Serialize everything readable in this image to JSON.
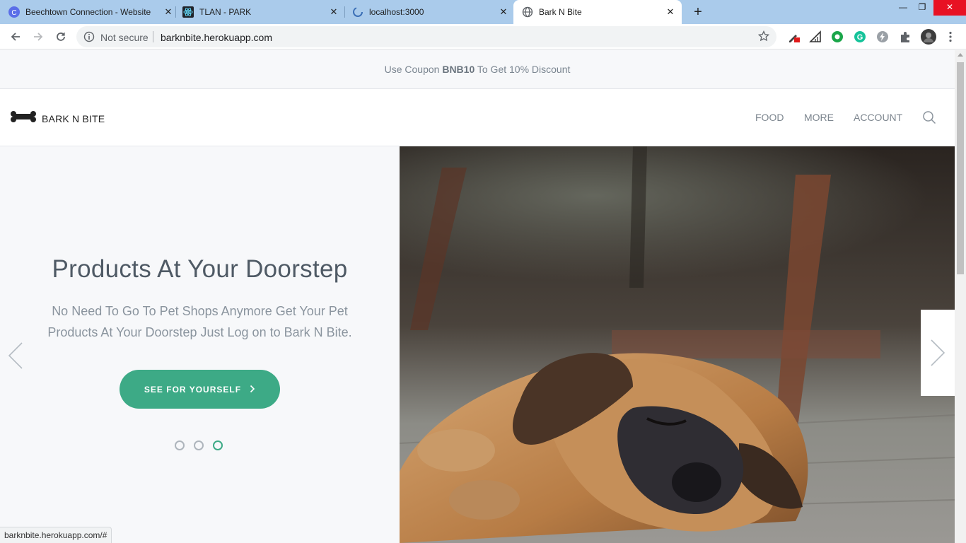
{
  "browser": {
    "tabs": [
      {
        "title": "Beechtown Connection - Website",
        "icon": "c-logo-icon"
      },
      {
        "title": "TLAN - PARK",
        "icon": "react-icon"
      },
      {
        "title": "localhost:3000",
        "icon": "spinner-icon"
      },
      {
        "title": "Bark N Bite",
        "icon": "globe-icon",
        "active": true
      }
    ],
    "security_label": "Not secure",
    "url": "barknbite.herokuapp.com",
    "status_url": "barknbite.herokuapp.com/#"
  },
  "site": {
    "coupon": {
      "prefix": "Use Coupon",
      "code": "BNB10",
      "suffix": "To Get 10% Discount"
    },
    "brand": "BARK N BITE",
    "nav": [
      "FOOD",
      "MORE",
      "ACCOUNT"
    ],
    "hero": {
      "title": "Products At Your Doorstep",
      "subtitle": "No Need To Go To Pet Shops Anymore Get Your Pet Products At Your Doorstep Just Log on to Bark N Bite.",
      "cta": "SEE FOR YOURSELF",
      "slide_count": 3,
      "active_slide": 3
    },
    "colors": {
      "accent": "#3daa86",
      "text": "#4f5a65",
      "muted": "#8a949e"
    }
  }
}
